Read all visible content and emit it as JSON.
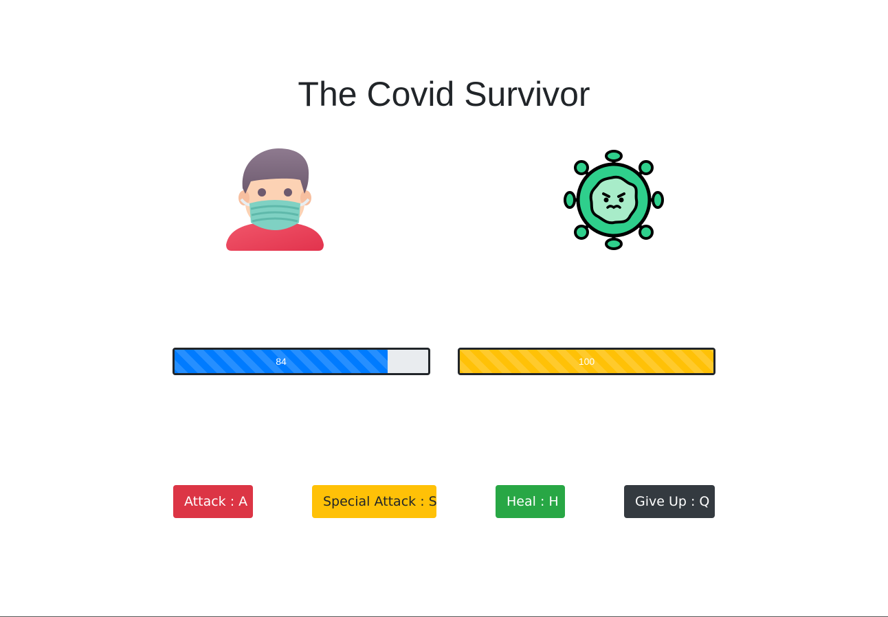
{
  "game": {
    "title": "The Covid Survivor"
  },
  "player": {
    "icon": "masked-person-icon",
    "health": 84,
    "health_label": "84",
    "bar_color": "#007bff"
  },
  "virus": {
    "icon": "virus-icon",
    "health": 100,
    "health_label": "100",
    "bar_color": "#ffc107"
  },
  "controls": {
    "attack": "Attack : A",
    "special_attack": "Special Attack : S",
    "heal": "Heal : H",
    "give_up": "Give Up : Q"
  },
  "colors": {
    "attack": "#dc3545",
    "special_attack": "#ffc107",
    "heal": "#28a745",
    "give_up": "#343a40"
  }
}
